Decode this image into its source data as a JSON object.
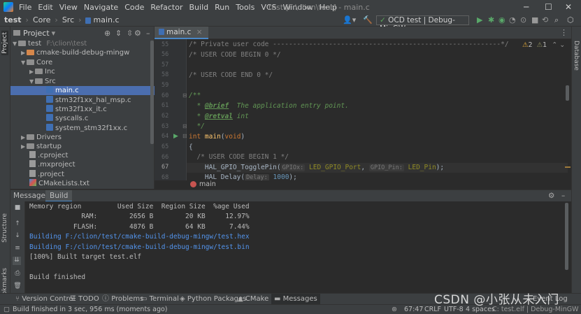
{
  "window": {
    "title": "test [F:\\clion\\test] - main.c",
    "menu": [
      "File",
      "Edit",
      "View",
      "Navigate",
      "Code",
      "Refactor",
      "Build",
      "Run",
      "Tools",
      "VCS",
      "Window",
      "Help"
    ]
  },
  "navbar": {
    "crumbs": [
      "test",
      "Core",
      "Src",
      "main.c"
    ],
    "run_config": "OCD test | Debug-MinGW"
  },
  "left_strip": {
    "project": "Project",
    "structure": "Structure",
    "bookmarks": "Bookmarks"
  },
  "right_strip": {
    "database": "Database"
  },
  "project_panel": {
    "title": "Project",
    "rows": [
      {
        "label": "test",
        "extra": "F:\\clion\\test"
      },
      {
        "label": "cmake-build-debug-mingw"
      },
      {
        "label": "Core"
      },
      {
        "label": "Inc"
      },
      {
        "label": "Src"
      },
      {
        "label": "main.c"
      },
      {
        "label": "stm32f1xx_hal_msp.c"
      },
      {
        "label": "stm32f1xx_it.c"
      },
      {
        "label": "syscalls.c"
      },
      {
        "label": "system_stm32f1xx.c"
      },
      {
        "label": "Drivers"
      },
      {
        "label": "startup"
      },
      {
        "label": ".cproject"
      },
      {
        "label": ".mxproject"
      },
      {
        "label": ".project"
      },
      {
        "label": "CMakeLists.txt"
      }
    ]
  },
  "editor": {
    "tab": "main.c",
    "inspection": {
      "warnings": "2",
      "weak": "1"
    },
    "line_numbers": [
      "55",
      "56",
      "57",
      "58",
      "59",
      "60",
      "61",
      "62",
      "63",
      "64",
      "65",
      "66",
      "67",
      "68"
    ],
    "lines": {
      "l55": "/* Private user code ---------------------------------------------------------*/",
      "l56": "/* USER CODE BEGIN 0 */",
      "l58": "/* USER CODE END 0 */",
      "l60": "/**",
      "l61_tag": "@brief",
      "l61_text": "  The application entry point.",
      "l62_tag": "@retval",
      "l62_text": " int",
      "l63": "  */",
      "l64_kw": "int",
      "l64_fn": "main",
      "l64_arg": "void",
      "l65": "{",
      "l66": "  /* USER CODE BEGIN 1 */",
      "l67_fn": "    HAL_GPIO_TogglePin(",
      "l67_hint1": "GPIOx:",
      "l67_arg1": "LED_GPIO_Port",
      "l67_hint2": "GPIO_Pin:",
      "l67_arg2": "LED_Pin",
      "l67_end": ");",
      "l68_fn": "    HAL_Delay(",
      "l68_hint": "Delay:",
      "l68_arg": "1000",
      "l68_end": ");"
    },
    "breadcrumb": "main"
  },
  "messages": {
    "label": "Messages:",
    "tab": "Build",
    "output": [
      "Memory region         Used Size  Region Size  %age Used",
      "             RAM:        2656 B        20 KB     12.97%",
      "           FLASH:        4876 B        64 KB      7.44%",
      "Building F:/clion/test/cmake-build-debug-mingw/test.hex",
      "Building F:/clion/test/cmake-build-debug-mingw/test.bin",
      "[100%] Built target test.elf",
      "",
      "Build finished"
    ]
  },
  "tool_tabs": [
    "Version Control",
    "TODO",
    "Problems",
    "Terminal",
    "Python Packages",
    "CMake",
    "Messages",
    "Event Log"
  ],
  "status": {
    "message": "Build finished in 3 sec, 956 ms (moments ago)",
    "position": "67:47",
    "line_sep": "CRLF",
    "encoding": "UTF-8",
    "indent": "4 spaces",
    "context": "C: test.elf | Debug-MinGW"
  },
  "watermark": "CSDN @小张从未入门",
  "colors": {
    "accent": "#4b6eaf",
    "background": "#2b2b2b",
    "panel": "#3c3f41",
    "link": "#5394ec"
  }
}
